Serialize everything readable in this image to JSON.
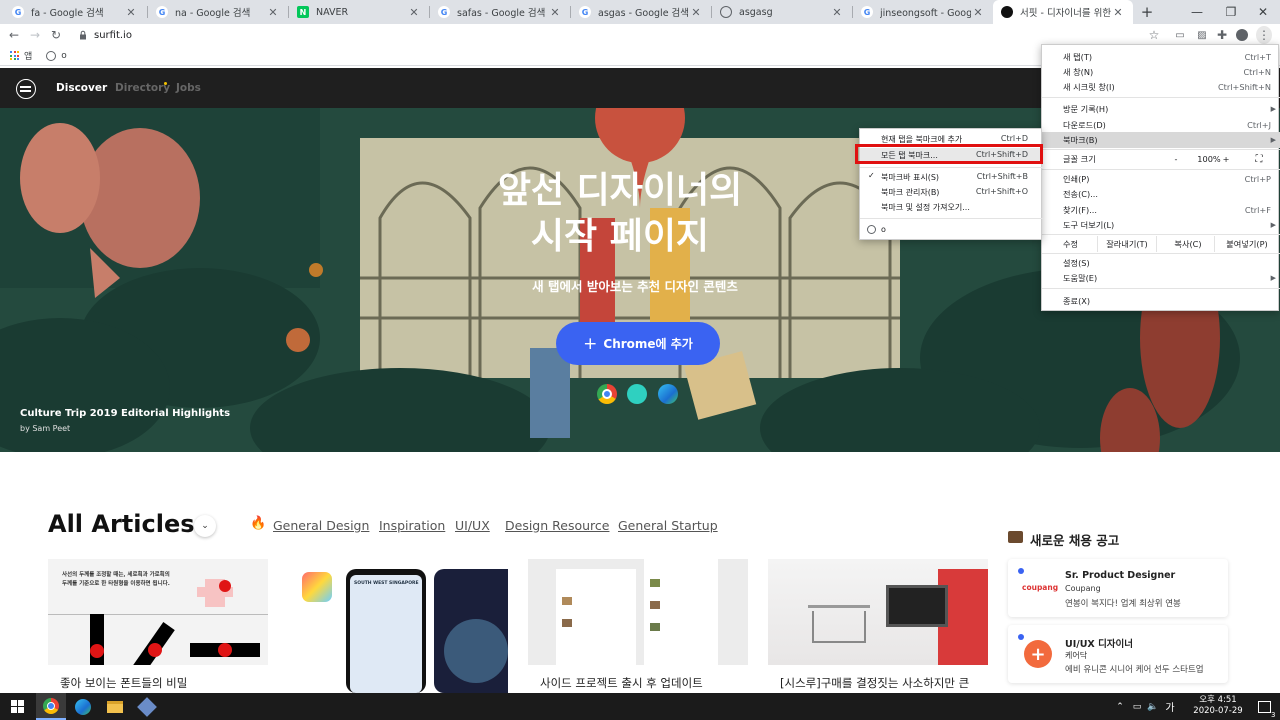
{
  "browser": {
    "tabs": [
      {
        "title": "fa - Google 검색",
        "favicon": "google-icon",
        "active": false
      },
      {
        "title": "na - Google 검색",
        "favicon": "google-icon",
        "active": false
      },
      {
        "title": "NAVER",
        "favicon": "naver-icon",
        "active": false
      },
      {
        "title": "safas - Google 검색",
        "favicon": "google-icon",
        "active": false
      },
      {
        "title": "asgas - Google 검색",
        "favicon": "google-icon",
        "active": false
      },
      {
        "title": "asgasg",
        "favicon": "globe-icon",
        "active": false
      },
      {
        "title": "jinseongsoft - Google 검색",
        "favicon": "google-icon",
        "active": false
      },
      {
        "title": "서핏 - 디자이너를 위한 드",
        "favicon": "surfit-icon",
        "active": true
      }
    ],
    "new_tab_symbol": "+",
    "url": "surfit.io",
    "bookmarks_bar": {
      "apps_label": "앱",
      "item_label": "o"
    }
  },
  "site": {
    "nav": {
      "discover": "Discover",
      "directory": "Directory",
      "jobs": "Jobs"
    },
    "hero": {
      "title_line1": "앞선 디자이너의",
      "title_line2": "시작 페이지",
      "subtitle": "새 탭에서 받아보는 추천 디자인 콘텐츠",
      "button": "Chrome에 추가",
      "credit_title": "Culture Trip 2019 Editorial Highlights",
      "credit_by": "by Sam Peet"
    },
    "articles": {
      "title": "All Articles",
      "categories": [
        "General Design",
        "Inspiration",
        "UI/UX",
        "Design Resource",
        "General Startup"
      ],
      "cards": [
        {
          "title": "좋아 보이는 폰트들의 비밀",
          "thumb_text": "사선의 두께를 조정할 때는, 세로획과 가로획의 두께를 기준으로 한 타원형을 이용하면 됩니다."
        },
        {
          "title": "",
          "thumb_text": "SOUTH WEST SINGAPORE"
        },
        {
          "title": "사이드 프로젝트 출시 후 업데이트",
          "thumb_text": ""
        },
        {
          "title": "[시스루]구매를 결정짓는 사소하지만 큰",
          "thumb_text": ""
        }
      ]
    },
    "jobs": {
      "title": "새로운 채용 공고",
      "items": [
        {
          "title": "Sr. Product Designer",
          "company": "Coupang",
          "desc": "연봉이 복지다! 업계 최상위 연봉",
          "logo_text": "coupang"
        },
        {
          "title": "UI/UX 디자이너",
          "company": "케어닥",
          "desc": "에비 유니콘 시니어 케어 선두 스타트업",
          "logo_text": ""
        }
      ]
    }
  },
  "main_menu": {
    "items": [
      {
        "label": "새 탭(T)",
        "shortcut": "Ctrl+T"
      },
      {
        "label": "새 창(N)",
        "shortcut": "Ctrl+N"
      },
      {
        "label": "새 시크릿 창(I)",
        "shortcut": "Ctrl+Shift+N"
      },
      {
        "label": "방문 기록(H)",
        "shortcut": ""
      },
      {
        "label": "다운로드(D)",
        "shortcut": "Ctrl+J"
      },
      {
        "label": "북마크(B)",
        "shortcut": ""
      },
      {
        "label": "글꼴 크기",
        "shortcut": ""
      },
      {
        "label": "인쇄(P)",
        "shortcut": "Ctrl+P"
      },
      {
        "label": "전송(C)...",
        "shortcut": ""
      },
      {
        "label": "찾기(F)...",
        "shortcut": "Ctrl+F"
      },
      {
        "label": "도구 더보기(L)",
        "shortcut": ""
      },
      {
        "label": "설정(S)",
        "shortcut": ""
      },
      {
        "label": "도움말(E)",
        "shortcut": ""
      },
      {
        "label": "종료(X)",
        "shortcut": ""
      }
    ],
    "zoom": {
      "minus": "-",
      "value": "100%",
      "plus": "+"
    },
    "edit": {
      "label": "수정",
      "cut": "잘라내기(T)",
      "copy": "복사(C)",
      "paste": "붙여넣기(P)"
    }
  },
  "bookmark_submenu": {
    "items": [
      {
        "label": "현재 탭을 북마크에 추가",
        "shortcut": "Ctrl+D"
      },
      {
        "label": "모든 탭 북마크...",
        "shortcut": "Ctrl+Shift+D"
      },
      {
        "label": "북마크바 표시(S)",
        "shortcut": "Ctrl+Shift+B",
        "checked": true
      },
      {
        "label": "북마크 관리자(B)",
        "shortcut": "Ctrl+Shift+O"
      },
      {
        "label": "북마크 및 설정 가져오기...",
        "shortcut": ""
      },
      {
        "label": "o",
        "shortcut": ""
      }
    ]
  },
  "taskbar": {
    "time": "오후 4:51",
    "date": "2020-07-29",
    "notifications": "3"
  },
  "colors": {
    "accent_blue": "#3a63f2",
    "highlight_red": "#e01010",
    "nav_dark": "#1f1f1f",
    "tab_strip": "#dee1e6"
  }
}
